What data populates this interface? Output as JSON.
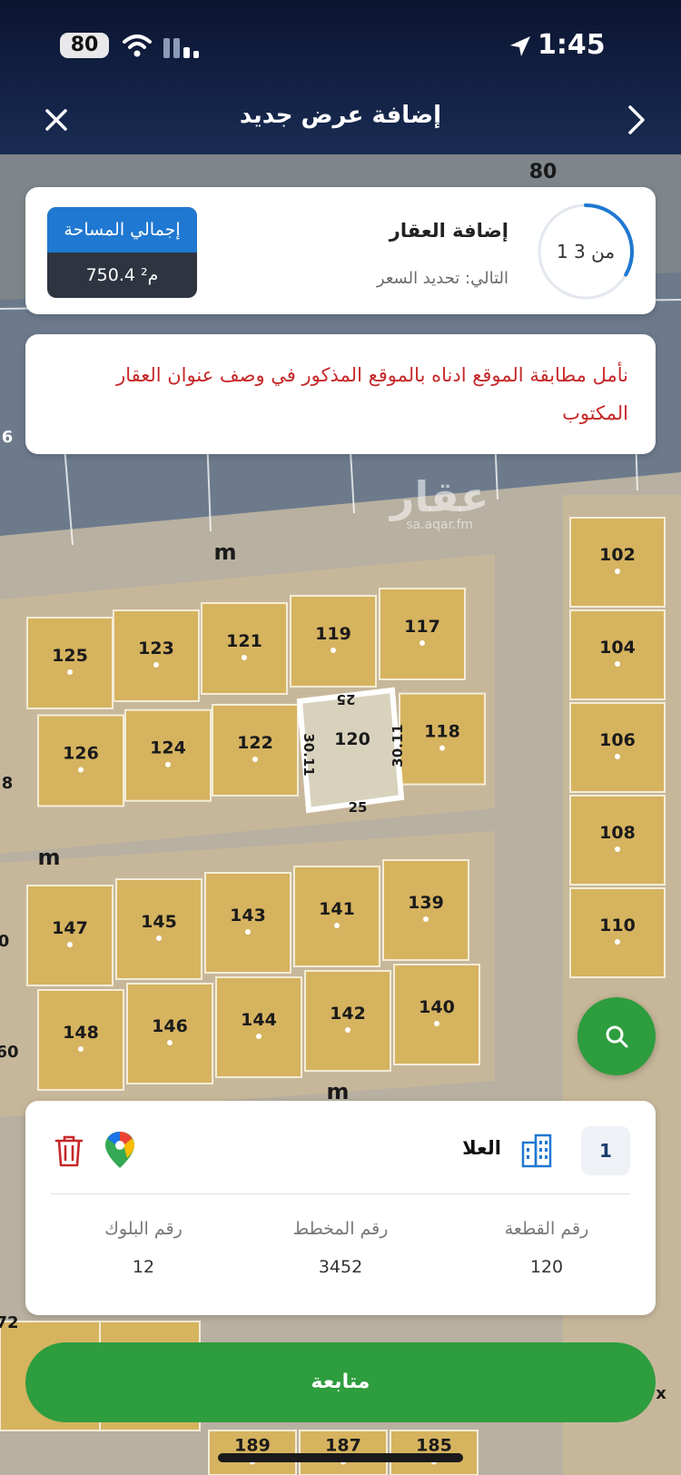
{
  "status_bar": {
    "time": "1:45",
    "battery": "80"
  },
  "header": {
    "title": "إضافة عرض جديد"
  },
  "step": {
    "progress_label": "1 من 3",
    "title": "إضافة العقار",
    "next": "التالي: تحديد السعر",
    "total_area_label": "إجمالي المساحة",
    "total_area_value": "750.4 م²"
  },
  "warning": {
    "text": "نأمل مطابقة الموقع ادناه بالموقع المذكور في وصف عنوان العقار المكتوب"
  },
  "map": {
    "watermark_logo": "عقار",
    "watermark_url": "sa.aqar.fm",
    "road_label": "m",
    "selected_plot": {
      "number": "120",
      "side_top": "25",
      "side_bottom": "25",
      "side_left": "30.11",
      "side_right": "30.11"
    },
    "top_edge_labels": [
      "80"
    ],
    "right_column_plots": [
      "102",
      "104",
      "106",
      "108",
      "110"
    ],
    "row1_plots": [
      "125",
      "123",
      "121",
      "119",
      "117"
    ],
    "row2_plots": [
      "126",
      "124",
      "122",
      "118"
    ],
    "row3_plots": [
      "147",
      "145",
      "143",
      "141",
      "139"
    ],
    "row4_plots": [
      "148",
      "146",
      "144",
      "142",
      "140"
    ],
    "bottom_plots": [
      "189",
      "187",
      "185"
    ],
    "edge_labels": [
      "6",
      "8",
      "0",
      "60",
      "72",
      "x"
    ]
  },
  "parcel": {
    "index": "1",
    "city": "العلا",
    "fields": [
      {
        "label": "رقم القطعة",
        "value": "120"
      },
      {
        "label": "رقم المخطط",
        "value": "3452"
      },
      {
        "label": "رقم البلوك",
        "value": "12"
      }
    ]
  },
  "actions": {
    "continue_label": "متابعة"
  },
  "icons": {
    "close": "close-icon",
    "forward": "chevron-right-icon",
    "search": "search-icon",
    "delete": "trash-icon",
    "maps": "google-maps-pin-icon",
    "building": "building-icon",
    "location": "location-arrow-icon",
    "wifi": "wifi-icon",
    "signal": "signal-icon"
  },
  "colors": {
    "primary_green": "#2e9d3e",
    "header_navy": "#132246",
    "area_blue": "#1f78d1",
    "warning_red": "#c62828",
    "parcel_fill": "#d6b35f",
    "road": "#b9b09f"
  }
}
